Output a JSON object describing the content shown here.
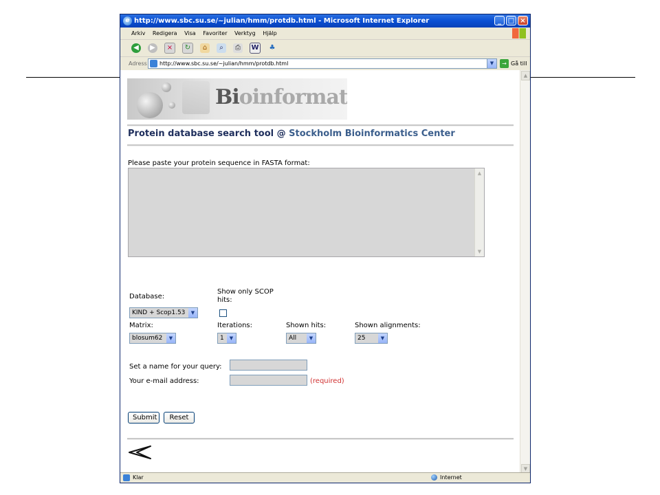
{
  "window": {
    "title": "http://www.sbc.su.se/~julian/hmm/protdb.html - Microsoft Internet Explorer"
  },
  "menu": [
    "Arkiv",
    "Redigera",
    "Visa",
    "Favoriter",
    "Verktyg",
    "Hjälp"
  ],
  "address": {
    "label": "Adress",
    "url": "http://www.sbc.su.se/~julian/hmm/protdb.html",
    "go_label": "Gå till"
  },
  "page": {
    "logo_highlight": "Bi",
    "logo_text": "oinformatics",
    "title_main": "Protein database search tool @ ",
    "title_center": "Stockholm Bioinformatics Center",
    "paste_label": "Please paste your protein sequence in FASTA format:",
    "database_label": "Database:",
    "database_value": "KIND + Scop1.53",
    "scop_label_line1": "Show only SCOP",
    "scop_label_line2": "hits:",
    "matrix_label": "Matrix:",
    "matrix_value": "blosum62",
    "iterations_label": "Iterations:",
    "iterations_value": "1",
    "shown_hits_label": "Shown hits:",
    "shown_hits_value": "All",
    "shown_alignments_label": "Shown alignments:",
    "shown_alignments_value": "25",
    "query_name_label": "Set a name for your query:",
    "email_label": "Your e-mail address:",
    "required_label": "(required)",
    "submit_label": "Submit",
    "reset_label": "Reset"
  },
  "status": {
    "text": "Klar",
    "zone": "Internet"
  }
}
